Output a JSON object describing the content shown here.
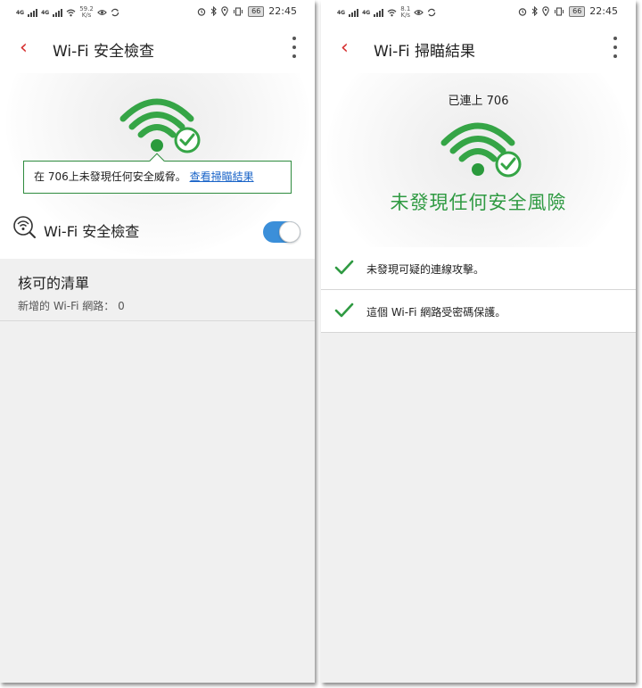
{
  "status_bar": {
    "network_1": "4G",
    "network_2": "4G",
    "left_speed_value": "59.2",
    "right_speed_value": "8.1",
    "speed_unit": "K/s",
    "battery": "66",
    "time": "22:45"
  },
  "left_screen": {
    "title": "Wi-Fi 安全檢查",
    "callout_text": "在 706上未發現任何安全威脅。",
    "callout_link": "查看掃瞄結果",
    "toggle_label": "Wi-Fi 安全檢查",
    "toggle_on": true,
    "approved_title": "核可的清單",
    "approved_subtitle": "新增的 Wi-Fi 網路： 0"
  },
  "right_screen": {
    "title": "Wi-Fi 掃瞄結果",
    "connected_text": "已連上 706",
    "headline": "未發現任何安全風險",
    "results": [
      {
        "text": "未發現可疑的連線攻擊。"
      },
      {
        "text": "這個 Wi-Fi 網路受密碼保護。"
      }
    ]
  },
  "icons": {
    "back": "chevron-left-icon",
    "menu": "more-vertical-icon",
    "wifi": "wifi-check-icon",
    "check": "checkmark-icon",
    "scan": "wifi-search-icon"
  },
  "colors": {
    "accent_red": "#d52b2b",
    "success_green": "#2f9a42",
    "toggle_blue": "#3b8fd9",
    "link_blue": "#1a64c8"
  }
}
